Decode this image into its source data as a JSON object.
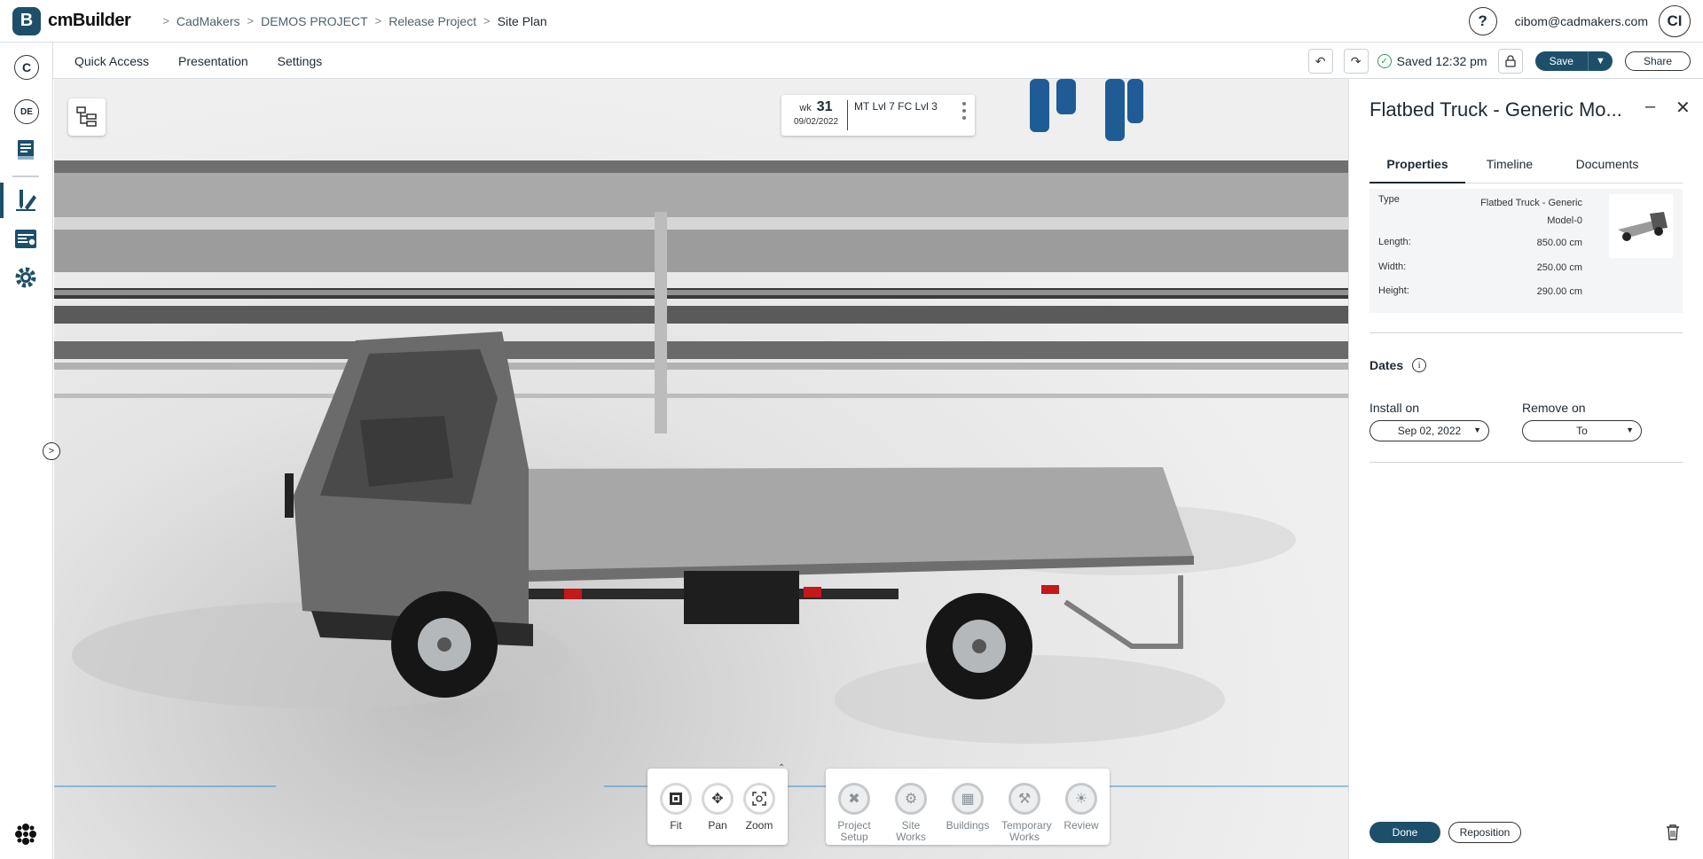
{
  "app": {
    "logo_letter": "B",
    "name": "cmBuilder",
    "brand_color": "#1d4f6b"
  },
  "breadcrumb": [
    {
      "label": "CadMakers"
    },
    {
      "label": "DEMOS PROJECT"
    },
    {
      "label": "Release Project"
    },
    {
      "label": "Site Plan"
    }
  ],
  "user": {
    "help_icon": "question-icon",
    "email": "cibom@cadmakers.com",
    "initials": "CI"
  },
  "leftrail": {
    "company_badge": "C",
    "user_badge": "DE",
    "items": [
      "book-icon",
      "design-tools-icon",
      "schedule-icon",
      "gear-icon"
    ],
    "bottom_icon": "apps-icon"
  },
  "toolbar": {
    "menu": [
      "Quick Access",
      "Presentation",
      "Settings"
    ],
    "saved_text": "Saved 12:32 pm",
    "save_label": "Save",
    "share_label": "Share"
  },
  "viewport": {
    "week": {
      "label": "wk",
      "number": "31",
      "date": "09/02/2022",
      "phase": "MT Lvl 7 FC Lvl 3"
    },
    "nav_tools": [
      {
        "label": "Fit",
        "icon": "fit-icon"
      },
      {
        "label": "Pan",
        "icon": "pan-icon"
      },
      {
        "label": "Zoom",
        "icon": "zoom-icon"
      }
    ],
    "category_tools": [
      {
        "label": "Project Setup",
        "line1": "Project",
        "line2": "Setup",
        "icon": "project-setup-icon"
      },
      {
        "label": "Site Works",
        "line1": "Site Works",
        "line2": "",
        "icon": "site-works-icon"
      },
      {
        "label": "Buildings",
        "line1": "Buildings",
        "line2": "",
        "icon": "buildings-icon"
      },
      {
        "label": "Temporary Works",
        "line1": "Temporary",
        "line2": "Works",
        "icon": "temporary-works-icon"
      },
      {
        "label": "Review",
        "line1": "Review",
        "line2": "",
        "icon": "review-icon"
      }
    ]
  },
  "panel": {
    "title": "Flatbed Truck - Generic Mo...",
    "tabs": [
      "Properties",
      "Timeline",
      "Documents"
    ],
    "active_tab": "Properties",
    "properties": {
      "type_key": "Type",
      "type_value_line1": "Flatbed Truck - Generic",
      "type_value_line2": "Model-0",
      "length_key": "Length:",
      "length_value": "850.00 cm",
      "width_key": "Width:",
      "width_value": "250.00 cm",
      "height_key": "Height:",
      "height_value": "290.00 cm"
    },
    "dates": {
      "label": "Dates",
      "install_label": "Install on",
      "install_value": "Sep 02, 2022",
      "remove_label": "Remove on",
      "remove_value": "To"
    },
    "done_label": "Done",
    "reposition_label": "Reposition"
  }
}
